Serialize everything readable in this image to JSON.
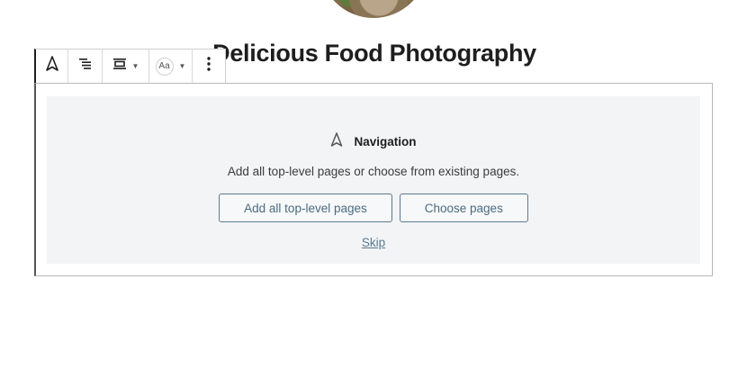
{
  "site": {
    "title": "Delicious Food Photography"
  },
  "toolbar": {
    "items": [
      {
        "icon": "navigation-icon"
      },
      {
        "icon": "list-indent-icon"
      },
      {
        "icon": "justify-icon",
        "has_dropdown": true
      },
      {
        "icon": "text-style-icon",
        "label": "Aa",
        "has_dropdown": true
      },
      {
        "icon": "more-options-icon"
      }
    ]
  },
  "navigation_block": {
    "label": "Navigation",
    "instructions": "Add all top-level pages or choose from existing pages.",
    "add_all_button": "Add all top-level pages",
    "choose_pages_button": "Choose pages",
    "skip_link": "Skip"
  },
  "colors": {
    "placeholder_bg": "#f3f4f6",
    "button_border": "#5a7b8f",
    "link": "#5a7b8f",
    "title": "#1e1e1e"
  }
}
